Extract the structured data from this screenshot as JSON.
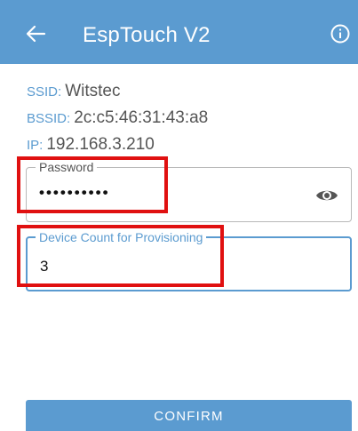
{
  "header": {
    "title": "EspTouch V2",
    "back_icon": "arrow-left-icon",
    "info_icon": "info-circle-icon",
    "background": "#5b9bd0"
  },
  "info": {
    "ssid_label": "SSID:",
    "ssid_value": "Witstec",
    "bssid_label": "BSSID:",
    "bssid_value": "2c:c5:46:31:43:a8",
    "ip_label": "IP:",
    "ip_value": "192.168.3.210"
  },
  "password": {
    "label": "Password",
    "value": "••••••••••",
    "toggle_icon": "eye-icon"
  },
  "device_count": {
    "label": "Device Count for Provisioning",
    "value": "3"
  },
  "confirm_label": "CONFIRM",
  "colors": {
    "accent": "#5b9bd0",
    "highlight": "#e01010"
  }
}
